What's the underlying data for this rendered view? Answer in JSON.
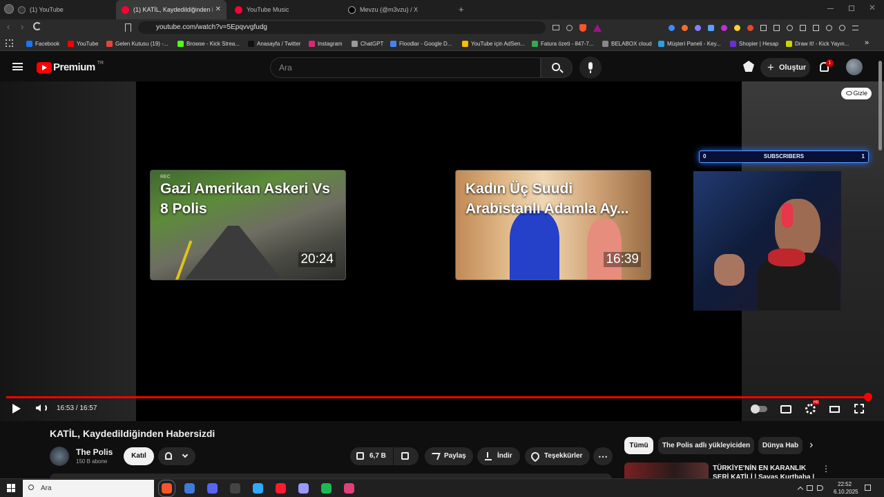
{
  "browser": {
    "tabs": [
      {
        "label": "(1) YouTube",
        "color": "#333333"
      },
      {
        "label": "(1) KATİL, Kaydedildiğinden Hab",
        "color": "#ff0033",
        "close": "✕"
      },
      {
        "label": "YouTube Music",
        "color": "#ff0033"
      },
      {
        "label": "Mevzu (@m3vzu) / X",
        "color": "#000000"
      }
    ],
    "new_tab": "+",
    "url": "youtube.com/watch?v=5Epqvvgfudg",
    "bookmarks": [
      {
        "label": "Facebook",
        "color": "#1877f2"
      },
      {
        "label": "YouTube",
        "color": "#ff0000"
      },
      {
        "label": "Gelen Kutusu (19) -...",
        "color": "#ea4335"
      },
      {
        "label": "Browse - Kick Strea...",
        "color": "#53fc18"
      },
      {
        "label": "Anasayfa / Twitter",
        "color": "#111111"
      },
      {
        "label": "Instagram",
        "color": "#d62976"
      },
      {
        "label": "ChatGPT",
        "color": "#9a9a9a"
      },
      {
        "label": "Floodlar - Google D...",
        "color": "#4285f4"
      },
      {
        "label": "YouTube için AdSen...",
        "color": "#fbbc04"
      },
      {
        "label": "Fatura özeti - 847-7...",
        "color": "#34a853"
      },
      {
        "label": "BELABOX cloud",
        "color": "#888888"
      },
      {
        "label": "Müşteri Paneli - Key...",
        "color": "#2aa1e0"
      },
      {
        "label": "Shopier | Hesap",
        "color": "#6b2fd6"
      },
      {
        "label": "Draw It! - Kick Yayın...",
        "color": "#c6d600"
      }
    ],
    "bookmarks_more": "»"
  },
  "youtube": {
    "logo_text": "Premium",
    "logo_region": "TR",
    "search_placeholder": "Ara",
    "create_label": "Oluştur",
    "notification_count": "1"
  },
  "player": {
    "end_cards": [
      {
        "title": "Gazi Amerikan Askeri Vs 8 Polis",
        "duration": "20:24",
        "rec": "REC"
      },
      {
        "title": "Kadın Üç Suudi Arabistanlı Adamla Ay...",
        "duration": "16:39"
      }
    ],
    "overlay_hide_label": "Gizle",
    "subscribers_widget": {
      "label": "SUBSCRIBERS",
      "left_value": "0",
      "right_value": "1"
    },
    "time_display": "16:53 / 16:57",
    "progress": 0.996,
    "settings_badge": "HD"
  },
  "video": {
    "title": "KATİL, Kaydedildiğinden Habersizdi",
    "channel": "The Polis",
    "subscribers": "150 B abone",
    "join_label": "Katıl",
    "likes": "6,7 B",
    "share_label": "Paylaş",
    "download_label": "İndir",
    "thanks_label": "Teşekkürler",
    "more_label": "⋯"
  },
  "sidebar": {
    "chips": [
      "Tümü",
      "The Polis adlı yükleyiciden",
      "Dünya Hab"
    ],
    "next_chip": "›",
    "recommended_title_line1": "TÜRKİYE'NİN EN KARANLIK",
    "recommended_title_line2": "SERİ KATİLİ | Savaş Kurtbaba |"
  },
  "taskbar": {
    "search_placeholder": "Ara",
    "time": "22:52",
    "date": "6.10.2025",
    "apps": [
      {
        "name": "brave",
        "color": "#fb542b"
      },
      {
        "name": "app-2",
        "color": "#3d7bd9"
      },
      {
        "name": "discord",
        "color": "#5865f2"
      },
      {
        "name": "obs",
        "color": "#444444"
      },
      {
        "name": "photoshop",
        "color": "#31a8ff"
      },
      {
        "name": "opera",
        "color": "#ff1b2d"
      },
      {
        "name": "premiere",
        "color": "#9999ff"
      },
      {
        "name": "spotify",
        "color": "#1db954"
      },
      {
        "name": "app-9",
        "color": "#e0407a"
      }
    ]
  }
}
